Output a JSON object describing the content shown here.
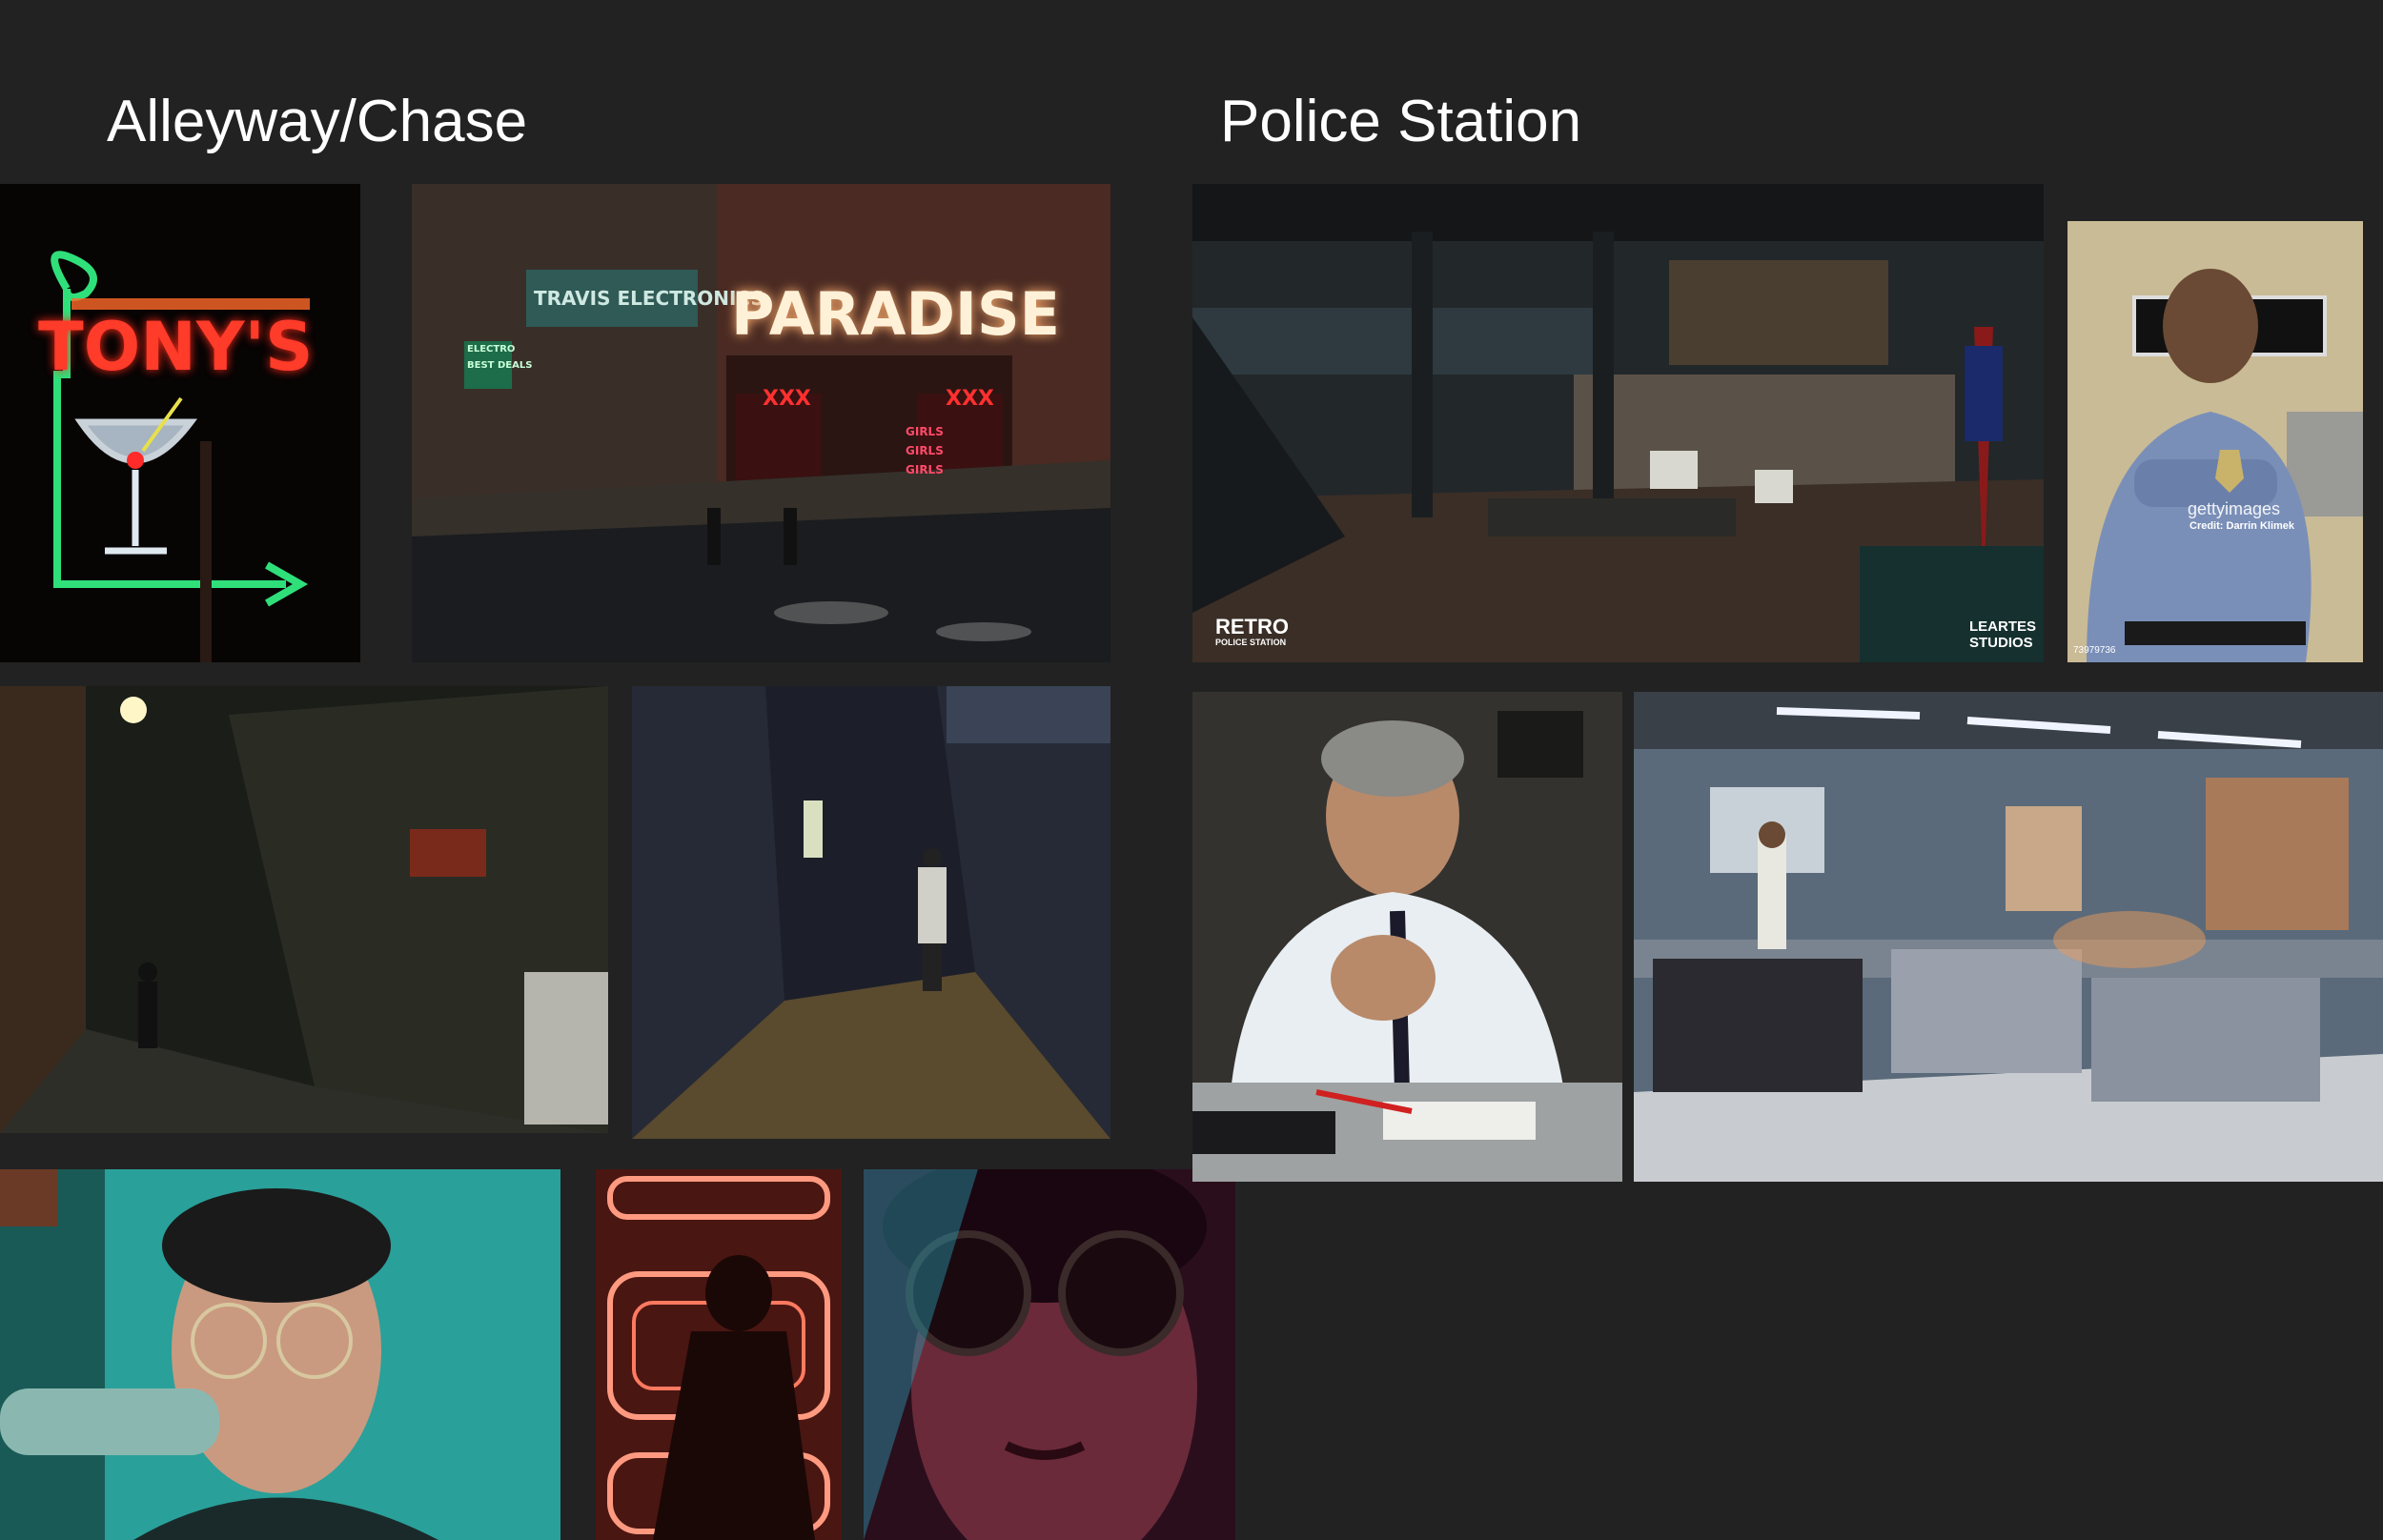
{
  "sections": {
    "alleyway": {
      "title": "Alleyway/Chase"
    },
    "police": {
      "title": "Police Station"
    }
  },
  "signs": {
    "tonys": "TONY'S",
    "paradise": "PARADISE",
    "travis": "TRAVIS ELECTRONICS",
    "electro": "ELECTRO",
    "best_deals": "BEST DEALS",
    "xxx_left": "XXX",
    "xxx_right": "XXX",
    "girls": "GIRLS GIRLS GIRLS"
  },
  "watermarks": {
    "retro_line1": "RETRO",
    "retro_line2": "POLICE STATION",
    "leartes_line1": "LEARTES",
    "leartes_line2": "STUDIOS",
    "getty": "gettyimages",
    "getty_credit": "Credit: Darrin Klimek",
    "getty_id": "73979736"
  },
  "colors": {
    "background": "#222222",
    "heading": "#ffffff",
    "neon_red": "#ff3b2a",
    "neon_green": "#2fe07a",
    "teal": "#1e8a86"
  }
}
